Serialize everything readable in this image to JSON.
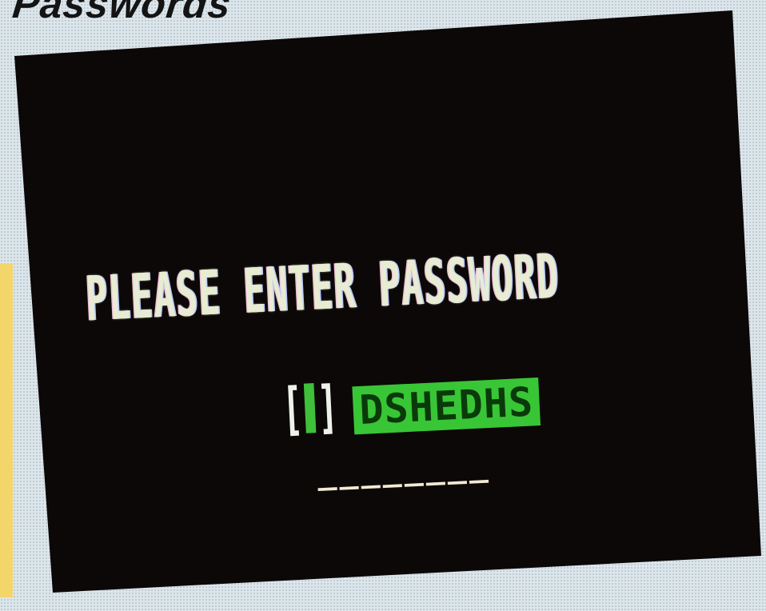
{
  "page": {
    "heading": "Passwords"
  },
  "game_screen": {
    "prompt": "PLEASE ENTER PASSWORD",
    "bracket_open": "[",
    "bracket_close": "]",
    "entered_text": "DSHEDHS",
    "input_underline": "________"
  },
  "colors": {
    "screen_background": "#0c0807",
    "prompt_text": "#e7ecd2",
    "entry_green": "#38c636",
    "page_background": "#dde6ea",
    "accent_yellow": "#f3d56a"
  }
}
